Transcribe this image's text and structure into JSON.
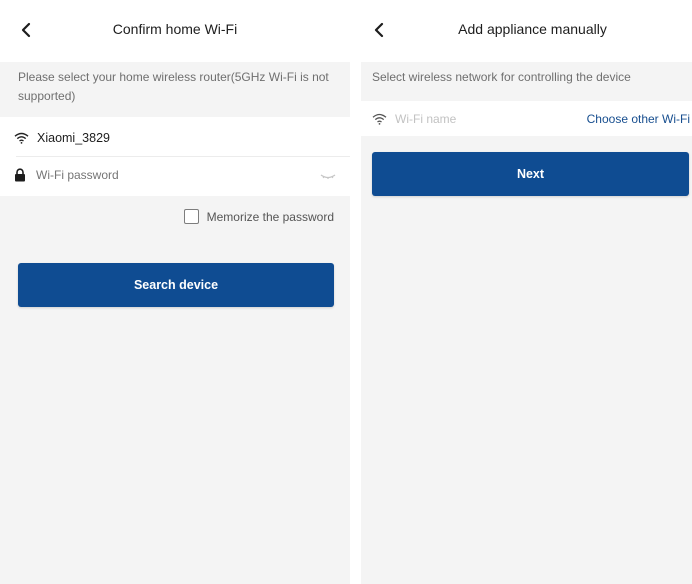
{
  "left_screen": {
    "title": "Confirm home Wi-Fi",
    "hint": "Please select your home wireless router(5GHz Wi-Fi is not supported)",
    "ssid": "Xiaomi_3829",
    "password_placeholder": "Wi-Fi password",
    "memorize_label": "Memorize the password",
    "search_button": "Search device"
  },
  "right_screen": {
    "title": "Add appliance manually",
    "hint": "Select wireless network for controlling the device",
    "wifi_placeholder": "Wi-Fi name",
    "choose_link": "Choose other Wi-Fi",
    "next_button": "Next"
  },
  "colors": {
    "accent": "#0f4c92",
    "link": "#174e8f",
    "background": "#f4f4f4"
  },
  "icons": [
    "back-arrow-icon",
    "wifi-icon",
    "lock-icon",
    "eye-icon"
  ]
}
